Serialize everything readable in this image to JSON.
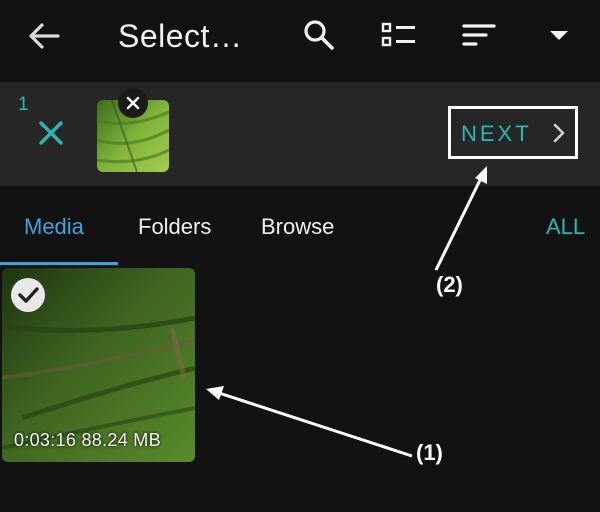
{
  "header": {
    "title": "Select…",
    "icons": [
      "back-arrow-icon",
      "search-icon",
      "list-view-icon",
      "sort-icon",
      "dropdown-icon"
    ]
  },
  "selection": {
    "count": "1",
    "next_label": "NEXT"
  },
  "tabs": [
    {
      "label": "Media",
      "active": true
    },
    {
      "label": "Folders",
      "active": false
    },
    {
      "label": "Browse",
      "active": false
    }
  ],
  "tab_all_label": "ALL",
  "media": [
    {
      "info": "0:03:16 88.24 MB",
      "selected": true
    }
  ],
  "annotations": [
    "(1)",
    "(2)"
  ],
  "colors": {
    "background": "#121212",
    "selection_bar": "#262626",
    "accent_teal": "#2bb7b3",
    "accent_blue": "#3fa4d9"
  }
}
